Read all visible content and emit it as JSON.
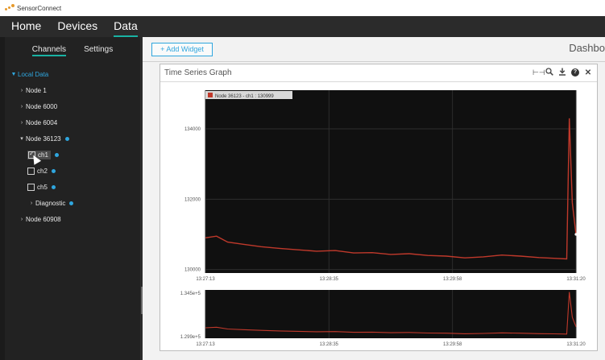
{
  "window": {
    "title": "SensorConnect"
  },
  "nav": {
    "items": [
      {
        "label": "Home",
        "active": false
      },
      {
        "label": "Devices",
        "active": false
      },
      {
        "label": "Data",
        "active": true
      }
    ]
  },
  "sidebar": {
    "tabs": [
      {
        "label": "Channels",
        "active": true
      },
      {
        "label": "Settings",
        "active": false
      }
    ],
    "root_label": "Local Data",
    "nodes": [
      {
        "label": "Node 1"
      },
      {
        "label": "Node 6000"
      },
      {
        "label": "Node 6004"
      },
      {
        "label": "Node 36123"
      },
      {
        "label": "Node 60908"
      }
    ],
    "channels": [
      {
        "label": "ch1",
        "checked": true
      },
      {
        "label": "ch2",
        "checked": false
      },
      {
        "label": "ch5",
        "checked": false
      }
    ],
    "diagnostic_label": "Diagnostic"
  },
  "main": {
    "add_widget_label": "+ Add Widget",
    "dashboard_title": "Dashbo"
  },
  "widget": {
    "title": "Time Series Graph",
    "tools": [
      "range-icon",
      "zoom-icon",
      "download-icon",
      "info-icon",
      "close-icon"
    ]
  },
  "chart_data": [
    {
      "type": "line",
      "series": [
        {
          "name": "Node 36123 - ch1 : 130999",
          "color": "#c0392b"
        }
      ],
      "x_ticks": [
        "13:27:13",
        "13:28:35",
        "13:29:58",
        "13:31:20"
      ],
      "y_ticks": [
        130000,
        132000,
        134000
      ],
      "ylim": [
        129900,
        135100
      ],
      "points": [
        [
          0,
          130900
        ],
        [
          0.03,
          130950
        ],
        [
          0.06,
          130780
        ],
        [
          0.1,
          130720
        ],
        [
          0.15,
          130650
        ],
        [
          0.2,
          130600
        ],
        [
          0.25,
          130560
        ],
        [
          0.3,
          130520
        ],
        [
          0.35,
          130540
        ],
        [
          0.4,
          130470
        ],
        [
          0.45,
          130480
        ],
        [
          0.5,
          130430
        ],
        [
          0.55,
          130450
        ],
        [
          0.6,
          130400
        ],
        [
          0.65,
          130380
        ],
        [
          0.7,
          130330
        ],
        [
          0.75,
          130360
        ],
        [
          0.8,
          130410
        ],
        [
          0.85,
          130380
        ],
        [
          0.9,
          130340
        ],
        [
          0.94,
          130320
        ],
        [
          0.975,
          130300
        ],
        [
          0.982,
          134300
        ],
        [
          0.99,
          131900
        ],
        [
          1.0,
          130999
        ]
      ],
      "grid": true
    },
    {
      "type": "line",
      "x_ticks": [
        "13:27:13",
        "13:28:35",
        "13:29:58",
        "13:31:20"
      ],
      "y_tick_labels": [
        "1.345e+5",
        "1.299e+5"
      ],
      "grid": true
    }
  ]
}
